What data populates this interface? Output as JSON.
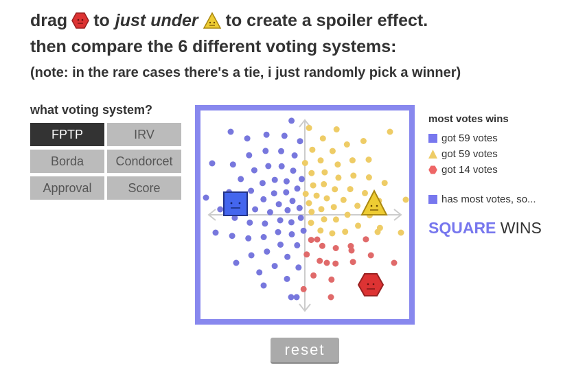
{
  "header": {
    "line1_part1": "drag",
    "line1_part2": "to",
    "line1_em": "just under",
    "line1_part3": "to create a spoiler effect.",
    "line2": "then compare the 6 different voting systems:",
    "line3": "(note: in the rare cases there's a tie, i just randomly pick a winner)"
  },
  "voting_systems": {
    "title": "what voting system?",
    "options": [
      "FPTP",
      "IRV",
      "Borda",
      "Condorcet",
      "Approval",
      "Score"
    ],
    "selected": "FPTP"
  },
  "simulation": {
    "candidates": [
      {
        "name": "square",
        "icon": "blue-square-face-icon",
        "color": "#4466ee"
      },
      {
        "name": "triangle",
        "icon": "yellow-triangle-face-icon",
        "color": "#eecc33"
      },
      {
        "name": "hexagon",
        "icon": "red-hexagon-face-icon",
        "color": "#dd3333"
      }
    ],
    "voter_colors": {
      "square": "#7777dd",
      "triangle": "#eecc66",
      "hexagon": "#e06a6a"
    }
  },
  "reset_label": "reset",
  "results": {
    "title": "most votes wins",
    "rows": [
      {
        "shape": "square",
        "text": "got 59 votes",
        "color": "#7777ee"
      },
      {
        "shape": "triangle",
        "text": "got 59 votes",
        "color": "#eecc66"
      },
      {
        "shape": "hexagon",
        "text": "got 14 votes",
        "color": "#ee6666"
      }
    ],
    "most_votes_text": "has most votes, so...",
    "winner_name": "SQUARE",
    "winner_suffix": "WINS"
  }
}
